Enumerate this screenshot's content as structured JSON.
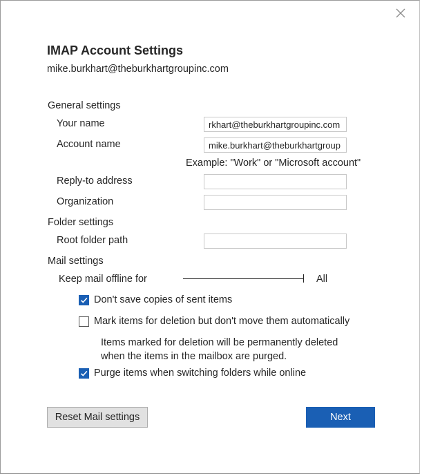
{
  "dialog": {
    "title": "IMAP Account Settings",
    "account_email": "mike.burkhart@theburkhartgroupinc.com"
  },
  "general": {
    "heading": "General settings",
    "your_name_label": "Your name",
    "your_name_value": "rkhart@theburkhartgroupinc.com",
    "account_name_label": "Account name",
    "account_name_value": "mike.burkhart@theburkhartgroup",
    "example_text": "Example: \"Work\" or \"Microsoft account\"",
    "reply_to_label": "Reply-to address",
    "reply_to_value": "",
    "organization_label": "Organization",
    "organization_value": ""
  },
  "folder": {
    "heading": "Folder settings",
    "root_path_label": "Root folder path",
    "root_path_value": ""
  },
  "mail": {
    "heading": "Mail settings",
    "offline_label": "Keep mail offline for",
    "offline_value": "All",
    "offline_level": 1.0,
    "dont_save_sent_label": "Don't save copies of sent items",
    "dont_save_sent_checked": true,
    "mark_deletion_label": "Mark items for deletion but don't move them automatically",
    "mark_deletion_checked": false,
    "mark_deletion_note": "Items marked for deletion will be permanently deleted when the items in the mailbox are purged.",
    "purge_label": "Purge items when switching folders while online",
    "purge_checked": true
  },
  "buttons": {
    "reset": "Reset Mail settings",
    "next": "Next"
  },
  "colors": {
    "accent": "#1a5fb4",
    "button_gray": "#e1e1e1"
  }
}
